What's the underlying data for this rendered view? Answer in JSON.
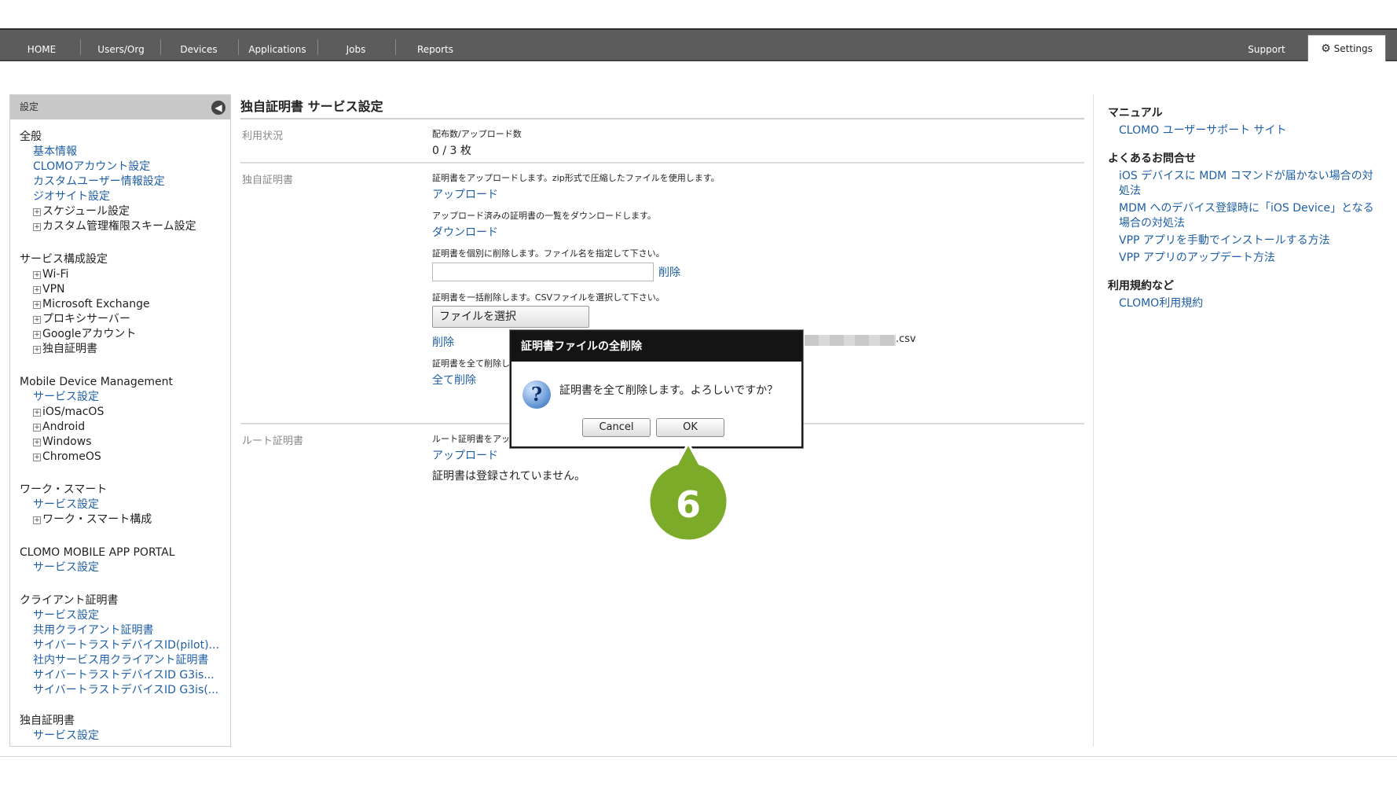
{
  "nav": {
    "items": [
      {
        "label": "HOME"
      },
      {
        "label": "Users/Org"
      },
      {
        "label": "Devices"
      },
      {
        "label": "Applications"
      },
      {
        "label": "Jobs"
      },
      {
        "label": "Reports"
      }
    ],
    "support": "Support",
    "settings": "Settings"
  },
  "sidebar": {
    "header": "設定",
    "groups": [
      {
        "title": "全般",
        "items": [
          {
            "label": "基本情報",
            "type": "link"
          },
          {
            "label": "CLOMOアカウント設定",
            "type": "link"
          },
          {
            "label": "カスタムユーザー情報設定",
            "type": "link"
          },
          {
            "label": "ジオサイト設定",
            "type": "link"
          },
          {
            "label": "スケジュール設定",
            "type": "expand"
          },
          {
            "label": "カスタム管理権限スキーム設定",
            "type": "expand"
          }
        ]
      },
      {
        "title": "サービス構成設定",
        "items": [
          {
            "label": "Wi-Fi",
            "type": "expand"
          },
          {
            "label": "VPN",
            "type": "expand"
          },
          {
            "label": "Microsoft Exchange",
            "type": "expand"
          },
          {
            "label": "プロキシサーバー",
            "type": "expand"
          },
          {
            "label": "Googleアカウント",
            "type": "expand"
          },
          {
            "label": "独自証明書",
            "type": "expand"
          }
        ]
      },
      {
        "title": "Mobile Device Management",
        "items": [
          {
            "label": "サービス設定",
            "type": "link"
          },
          {
            "label": "iOS/macOS",
            "type": "expand"
          },
          {
            "label": "Android",
            "type": "expand"
          },
          {
            "label": "Windows",
            "type": "expand"
          },
          {
            "label": "ChromeOS",
            "type": "expand"
          }
        ]
      },
      {
        "title": "ワーク・スマート",
        "items": [
          {
            "label": "サービス設定",
            "type": "link"
          },
          {
            "label": "ワーク・スマート構成",
            "type": "expand"
          }
        ]
      },
      {
        "title": "CLOMO MOBILE APP PORTAL",
        "items": [
          {
            "label": "サービス設定",
            "type": "link"
          }
        ]
      },
      {
        "title": "クライアント証明書",
        "items": [
          {
            "label": "サービス設定",
            "type": "link"
          },
          {
            "label": "共用クライアント証明書",
            "type": "link"
          },
          {
            "label": "サイバートラストデバイスID(pilot)...",
            "type": "link"
          },
          {
            "label": "社内サービス用クライアント証明書",
            "type": "link"
          },
          {
            "label": "サイバートラストデバイスID G3is...",
            "type": "link"
          },
          {
            "label": "サイバートラストデバイスID G3is(...",
            "type": "link"
          }
        ]
      },
      {
        "title": "独自証明書",
        "items": [
          {
            "label": "サービス設定",
            "type": "link"
          }
        ]
      }
    ]
  },
  "main": {
    "title": "独自証明書 サービス設定",
    "usage": {
      "label": "利用状況",
      "desc": "配布数/アップロード数",
      "value": "0 / 3 枚"
    },
    "own_cert": {
      "label": "独自証明書",
      "upload_desc": "証明書をアップロードします。zip形式で圧縮したファイルを使用します。",
      "upload_link": "アップロード",
      "download_desc": "アップロード済みの証明書の一覧をダウンロードします。",
      "download_link": "ダウンロード",
      "delete_one_desc": "証明書を個別に削除します。ファイル名を指定して下さい。",
      "delete_one_input": "",
      "delete_one_link": "削除",
      "bulk_desc": "証明書を一括削除します。CSVファイルを選択して下さい。",
      "file_button": "ファイルを選択",
      "file_suffix": ".csv",
      "bulk_link": "削除",
      "delete_all_desc": "証明書を全て削除します。",
      "delete_all_link": "全て削除"
    },
    "root_cert": {
      "label": "ルート証明書",
      "desc": "ルート証明書をアップロードします。",
      "upload_link": "アップロード",
      "empty": "証明書は登録されていません。"
    }
  },
  "right": {
    "sections": [
      {
        "title": "マニュアル",
        "links": [
          "CLOMO ユーザーサポート サイト"
        ]
      },
      {
        "title": "よくあるお問合せ",
        "links": [
          "iOS デバイスに MDM コマンドが届かない場合の対処法",
          "MDM へのデバイス登録時に「iOS Device」となる場合の対処法",
          "VPP アプリを手動でインストールする方法",
          "VPP アプリのアップデート方法"
        ]
      },
      {
        "title": "利用規約など",
        "links": [
          "CLOMO利用規約"
        ]
      }
    ]
  },
  "dialog": {
    "title": "証明書ファイルの全削除",
    "message": "証明書を全て削除します。よろしいですか？",
    "cancel": "Cancel",
    "ok": "OK",
    "icon": "question-icon"
  },
  "step_marker": {
    "number": "6",
    "color": "#7cab2a"
  }
}
